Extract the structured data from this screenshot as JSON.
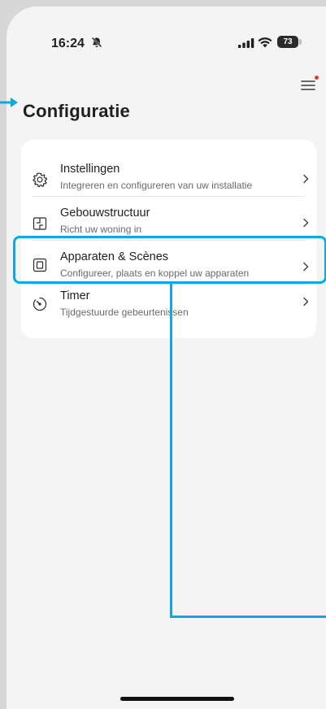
{
  "status_bar": {
    "time": "16:24",
    "battery": "73"
  },
  "header": {
    "title": "Configuratie"
  },
  "menu": {
    "items": [
      {
        "title": "Instellingen",
        "subtitle": "Integreren en configureren van uw installatie",
        "icon": "gear-icon"
      },
      {
        "title": "Gebouwstructuur",
        "subtitle": "Richt uw woning in",
        "icon": "floorplan-icon"
      },
      {
        "title": "Apparaten & Scènes",
        "subtitle": "Configureer, plaats en koppel uw apparaten",
        "icon": "device-icon"
      },
      {
        "title": "Timer",
        "subtitle": "Tijdgestuurde gebeurtenissen",
        "icon": "timer-icon"
      }
    ]
  },
  "colors": {
    "highlight": "#12a6e3",
    "notification_dot": "#e5322d",
    "background": "#f4f4f4",
    "card": "#ffffff"
  }
}
